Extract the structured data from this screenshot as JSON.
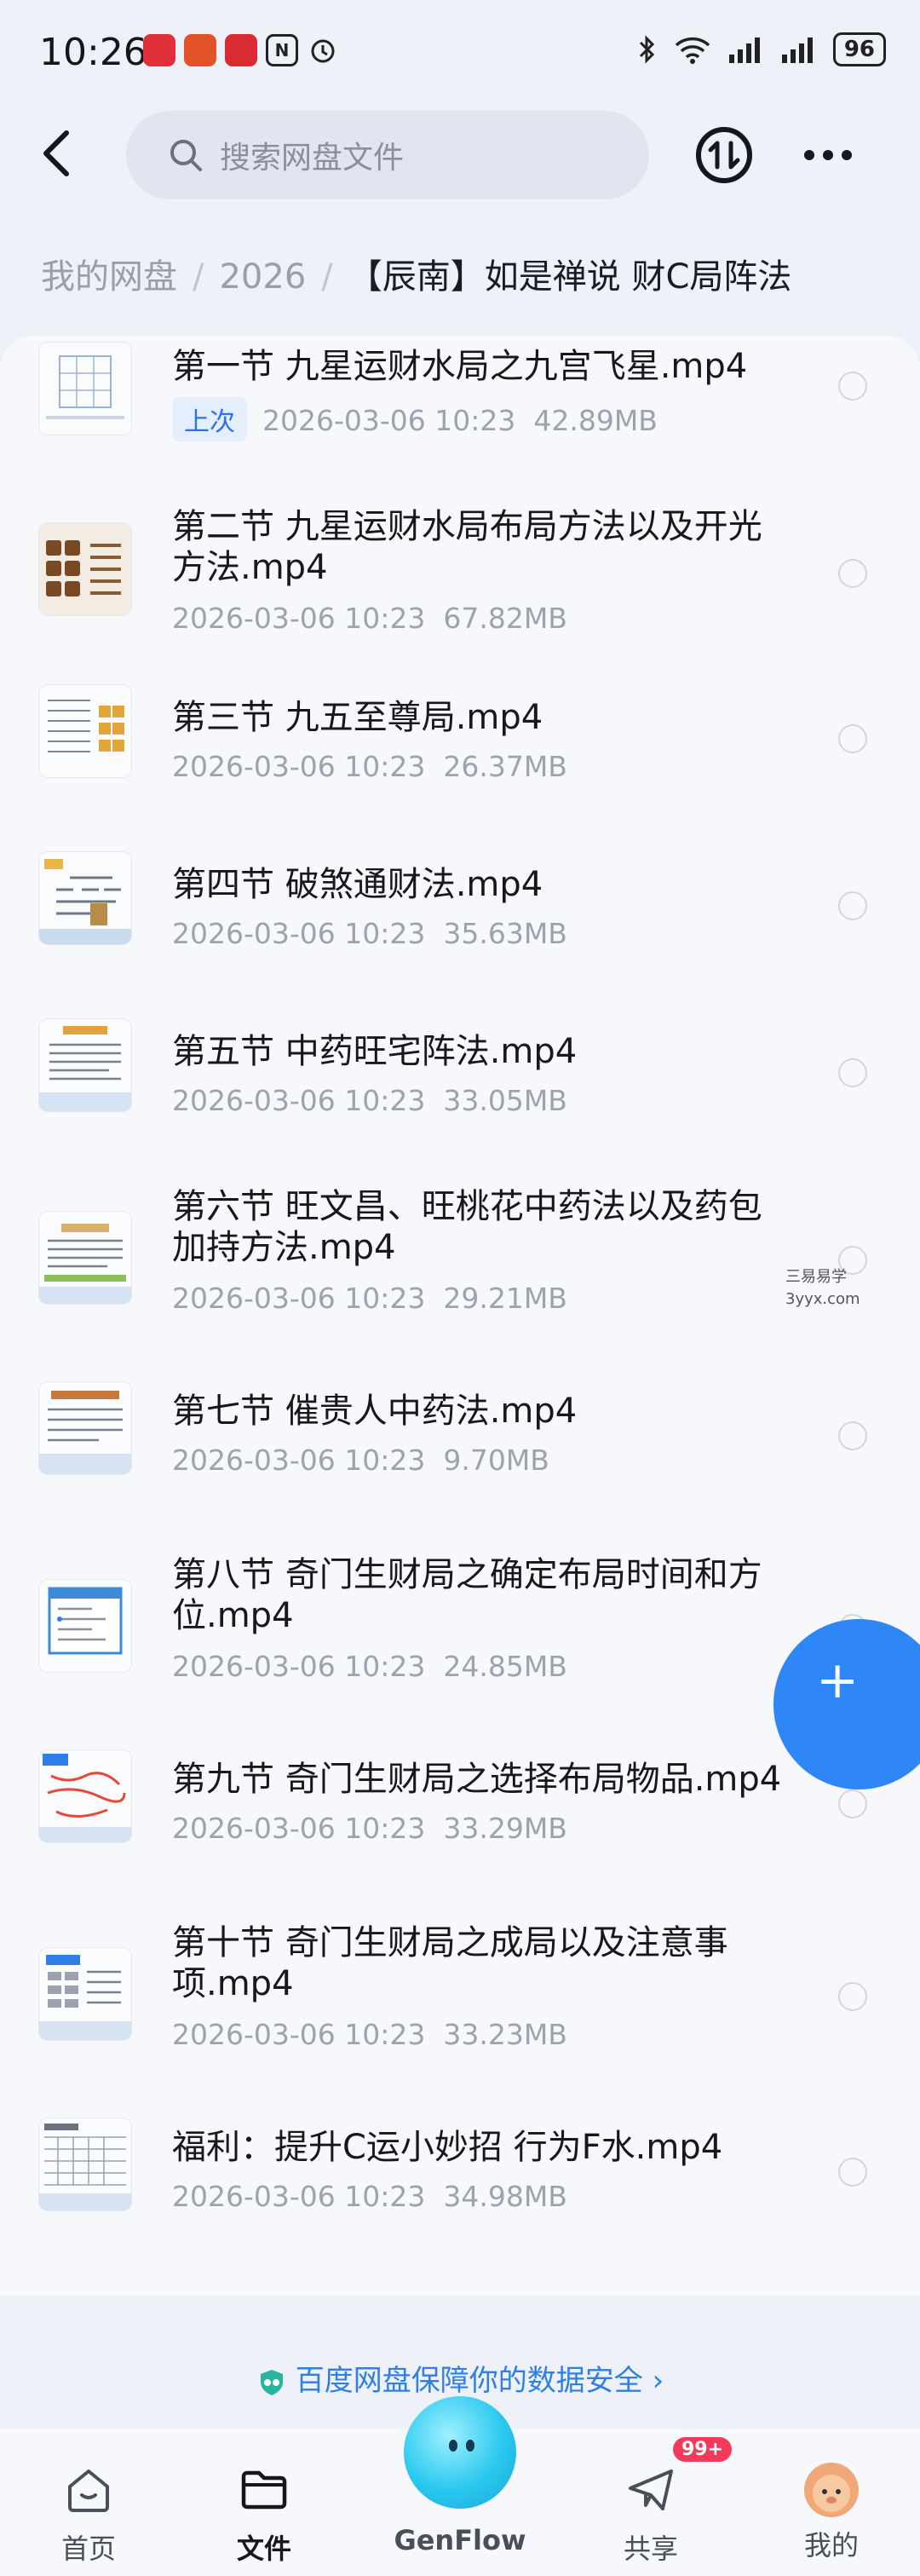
{
  "status_bar": {
    "time": "10:26",
    "battery": "96",
    "signal_label": "6"
  },
  "header": {
    "search_placeholder": "搜索网盘文件"
  },
  "breadcrumb": {
    "items": [
      "我的网盘",
      "2026"
    ],
    "current": "【辰南】如是禅说 财C局阵法"
  },
  "files": [
    {
      "name": "第一节 九星运财水局之九宫飞星.mp4",
      "badge": "上次",
      "date": "2026-03-06  10:23",
      "size": "42.89MB"
    },
    {
      "name": "第二节 九星运财水局布局方法以及开光方法.mp4",
      "date": "2026-03-06  10:23",
      "size": "67.82MB"
    },
    {
      "name": "第三节 九五至尊局.mp4",
      "date": "2026-03-06  10:23",
      "size": "26.37MB"
    },
    {
      "name": "第四节 破煞通财法.mp4",
      "date": "2026-03-06  10:23",
      "size": "35.63MB"
    },
    {
      "name": "第五节 中药旺宅阵法.mp4",
      "date": "2026-03-06  10:23",
      "size": "33.05MB"
    },
    {
      "name": "第六节 旺文昌、旺桃花中药法以及药包加持方法.mp4",
      "date": "2026-03-06  10:23",
      "size": "29.21MB"
    },
    {
      "name": "第七节 催贵人中药法.mp4",
      "date": "2026-03-06  10:23",
      "size": "9.70MB"
    },
    {
      "name": "第八节 奇门生财局之确定布局时间和方位.mp4",
      "date": "2026-03-06  10:23",
      "size": "24.85MB"
    },
    {
      "name": "第九节 奇门生财局之选择布局物品.mp4",
      "date": "2026-03-06  10:23",
      "size": "33.29MB"
    },
    {
      "name": "第十节 奇门生财局之成局以及注意事项.mp4",
      "date": "2026-03-06  10:23",
      "size": "33.23MB"
    },
    {
      "name": "福利：提升C运小妙招 行为F水.mp4",
      "date": "2026-03-06  10:23",
      "size": "34.98MB"
    }
  ],
  "watermark": {
    "line1": "三易易学",
    "line2": "3yyx.com"
  },
  "security_note": "百度网盘保障你的数据安全",
  "bottom_nav": {
    "home": "首页",
    "files": "文件",
    "genflow": "GenFlow",
    "share": "共享",
    "share_badge": "99+",
    "mine": "我的"
  },
  "colors": {
    "accent": "#2f7fe8",
    "badge": "#f43a5b"
  }
}
